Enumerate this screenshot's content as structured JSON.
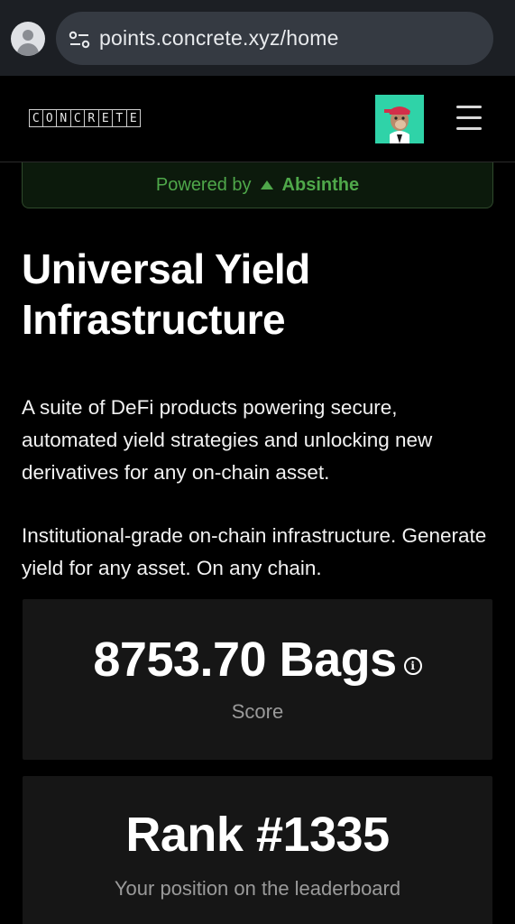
{
  "browser": {
    "url": "points.concrete.xyz/home",
    "profile_icon": "account-circle-icon",
    "site_settings_icon": "tune-icon"
  },
  "header": {
    "logo_letters": [
      "C",
      "O",
      "N",
      "C",
      "R",
      "E",
      "T",
      "E"
    ],
    "avatar_icon": "nft-ape-avatar",
    "menu_icon": "hamburger-menu-icon"
  },
  "powered": {
    "label": "Powered by",
    "brand": "Absinthe",
    "brand_icon": "triangle-up-icon",
    "color": "#4fa84a"
  },
  "hero": {
    "title": "Universal Yield Infrastructure",
    "description": "A suite of DeFi products powering secure, automated yield strategies and unlocking new derivatives for any on-chain asset.",
    "description2": "Institutional-grade on-chain infrastructure. Generate yield for any asset. On any chain."
  },
  "score": {
    "value": "8753.70 Bags",
    "label": "Score",
    "info_icon": "info-icon"
  },
  "rank": {
    "value": "Rank #1335",
    "label": "Your position on the leaderboard"
  }
}
